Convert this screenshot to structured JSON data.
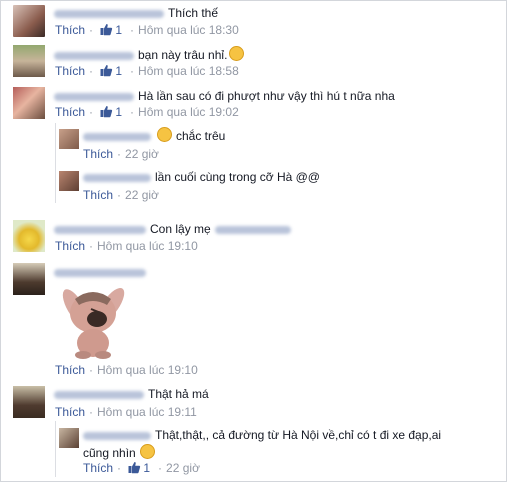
{
  "comments": [
    {
      "text": "Thích thế",
      "like": "Thích",
      "likes": "1",
      "time": "Hôm qua lúc 18:30"
    },
    {
      "text": "bạn này trâu nhỉ.",
      "like": "Thích",
      "likes": "1",
      "time": "Hôm qua lúc 18:58"
    },
    {
      "text": "Hà lần sau có đi phượt như vậy thì hú t nữa nha",
      "like": "Thích",
      "likes": "1",
      "time": "Hôm qua lúc 19:02"
    },
    {
      "text": "chắc trêu",
      "like": "Thích",
      "time": "22 giờ"
    },
    {
      "text": "lần cuối cùng trong cỡ Hà @@",
      "like": "Thích",
      "time": "22 giờ"
    },
    {
      "text": "Con lậy mẹ",
      "like": "Thích",
      "time": "Hôm qua lúc 19:10"
    },
    {
      "sticker": "rabbit-sticker",
      "like": "Thích",
      "time": "Hôm qua lúc 19:10"
    },
    {
      "text": "Thật hả má",
      "like": "Thích",
      "time": "Hôm qua lúc 19:11"
    },
    {
      "text_line1": "Thật,thật,, cả đường từ Hà Nội về,chỉ có t đi xe đạp,ai",
      "text_line2": "cũng nhìn",
      "like": "Thích",
      "likes": "1",
      "time": "22 giờ"
    }
  ],
  "colors": {
    "link": "#3b5998",
    "meta": "#9197a3",
    "text": "#141823"
  },
  "icons": [
    "thumbs-up-icon",
    "smile-emoji-icon",
    "tongue-emoji-icon",
    "grin-emoji-icon"
  ]
}
